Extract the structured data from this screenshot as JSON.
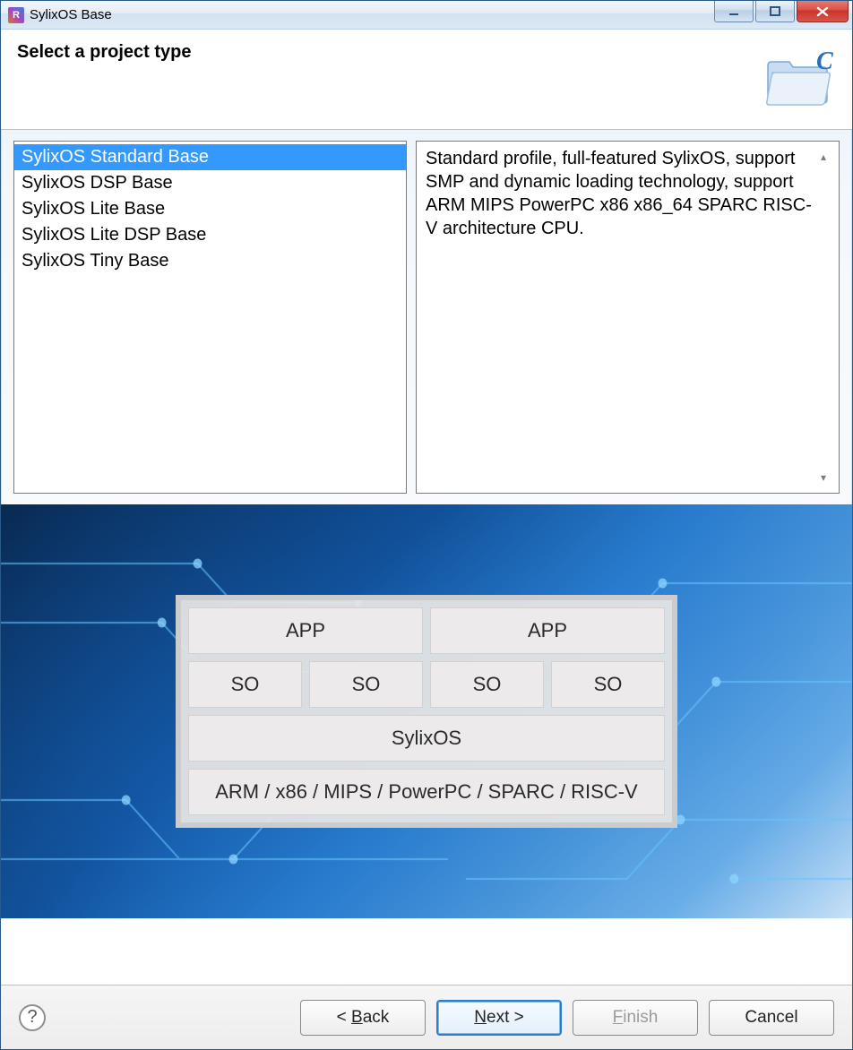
{
  "window": {
    "title": "SylixOS Base"
  },
  "header": {
    "title": "Select a project type"
  },
  "projectTypes": {
    "selectedIndex": 0,
    "items": [
      {
        "label": "SylixOS Standard Base"
      },
      {
        "label": "SylixOS DSP Base"
      },
      {
        "label": "SylixOS Lite Base"
      },
      {
        "label": "SylixOS Lite DSP Base"
      },
      {
        "label": "SylixOS Tiny Base"
      }
    ]
  },
  "description": "Standard profile, full-featured SylixOS, support SMP and dynamic loading technology, support ARM MIPS PowerPC x86 x86_64 SPARC RISC-V architecture CPU.",
  "diagram": {
    "row1": [
      "APP",
      "APP"
    ],
    "row2": [
      "SO",
      "SO",
      "SO",
      "SO"
    ],
    "row3": "SylixOS",
    "row4": "ARM / x86 / MIPS / PowerPC / SPARC / RISC-V"
  },
  "buttons": {
    "back": "< Back",
    "next": "Next >",
    "finish": "Finish",
    "cancel": "Cancel"
  }
}
